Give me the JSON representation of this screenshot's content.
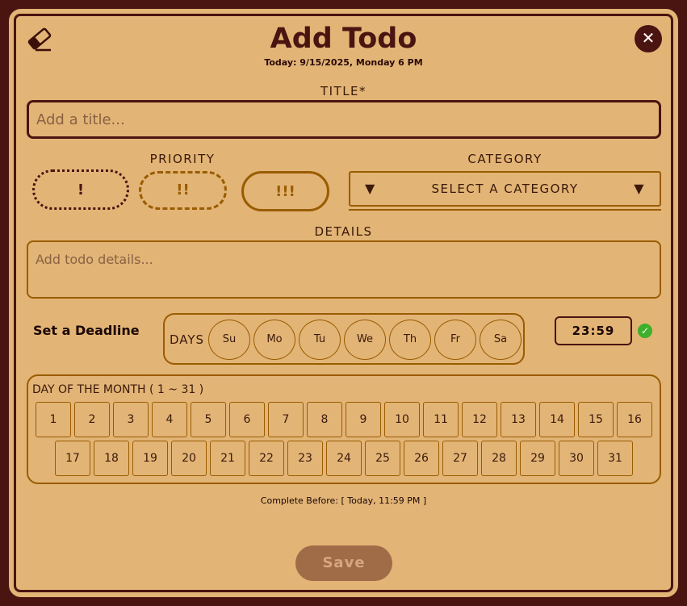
{
  "header": {
    "title": "Add Todo",
    "today": "Today: 9/15/2025, Monday 6 PM",
    "close": "✕"
  },
  "title_field": {
    "label": "TITLE*",
    "placeholder": "Add a title...",
    "value": ""
  },
  "priority": {
    "label": "PRIORITY",
    "options": [
      "!",
      "!!",
      "!!!"
    ]
  },
  "category": {
    "label": "CATEGORY",
    "selected": "SELECT A CATEGORY",
    "arrow": "▼"
  },
  "details_field": {
    "label": "DETAILS",
    "placeholder": "Add todo details...",
    "value": ""
  },
  "deadline": {
    "label": "Set a Deadline",
    "days_label": "DAYS",
    "days": [
      "Su",
      "Mo",
      "Tu",
      "We",
      "Th",
      "Fr",
      "Sa"
    ],
    "time": "23:59",
    "check": "✓"
  },
  "month": {
    "label": "DAY OF THE MONTH ( 1 ~ 31 )",
    "row1": [
      "1",
      "2",
      "3",
      "4",
      "5",
      "6",
      "7",
      "8",
      "9",
      "10",
      "11",
      "12",
      "13",
      "14",
      "15",
      "16"
    ],
    "row2": [
      "17",
      "18",
      "19",
      "20",
      "21",
      "22",
      "23",
      "24",
      "25",
      "26",
      "27",
      "28",
      "29",
      "30",
      "31"
    ]
  },
  "complete_before": "Complete Before: [ Today, 11:59 PM ]",
  "save_label": "Save",
  "colors": {
    "background": "#e2b476",
    "border": "#4a1410",
    "accent": "#9a5c00",
    "save": "#a06c48",
    "check": "#3cb02a"
  }
}
